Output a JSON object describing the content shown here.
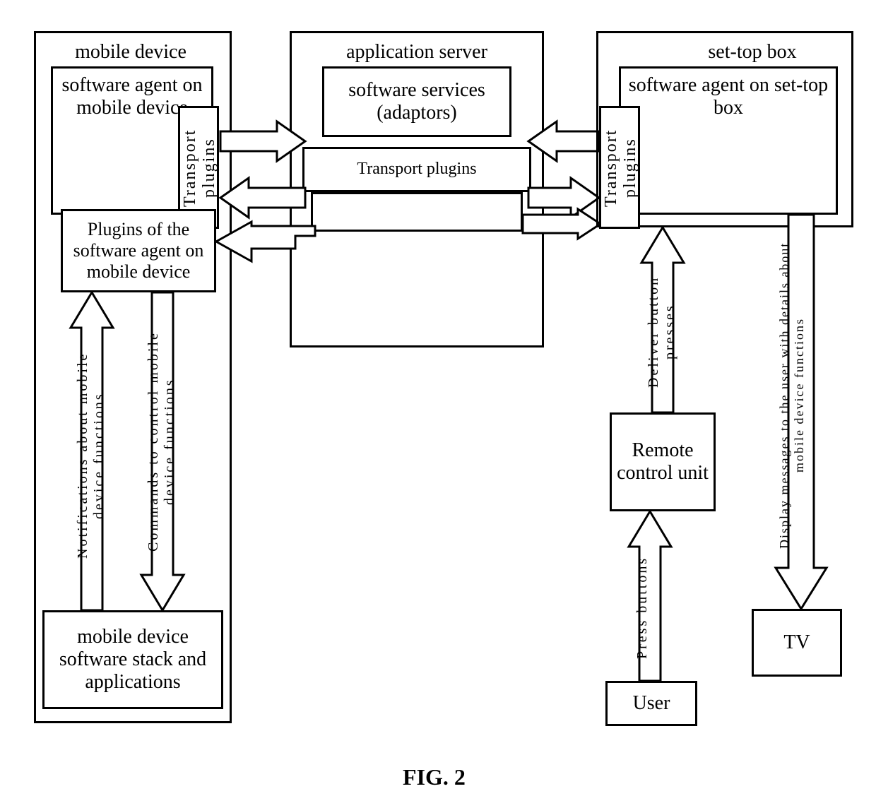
{
  "figure_label": "FIG. 2",
  "mobile": {
    "title": "mobile device",
    "agent": "software agent on mobile device",
    "transport": "Transport plugins",
    "plugins": "Plugins of the software agent on mobile device",
    "stack": "mobile device software stack and applications",
    "arrow_up": "Notifications about mobile device functions",
    "arrow_down": "Commands to control mobile device functions"
  },
  "server": {
    "title": "application server",
    "services": "software services (adaptors)",
    "transport": "Transport plugins"
  },
  "stb": {
    "title": "set-top box",
    "agent": "software agent on set-top box",
    "transport": "Transport plugins",
    "remote": "Remote control unit",
    "user": "User",
    "tv": "TV",
    "arrow_press": "Press buttons",
    "arrow_deliver": "Deliver button presses",
    "arrow_display": "Display messages to the user with details about mobile device functions"
  }
}
